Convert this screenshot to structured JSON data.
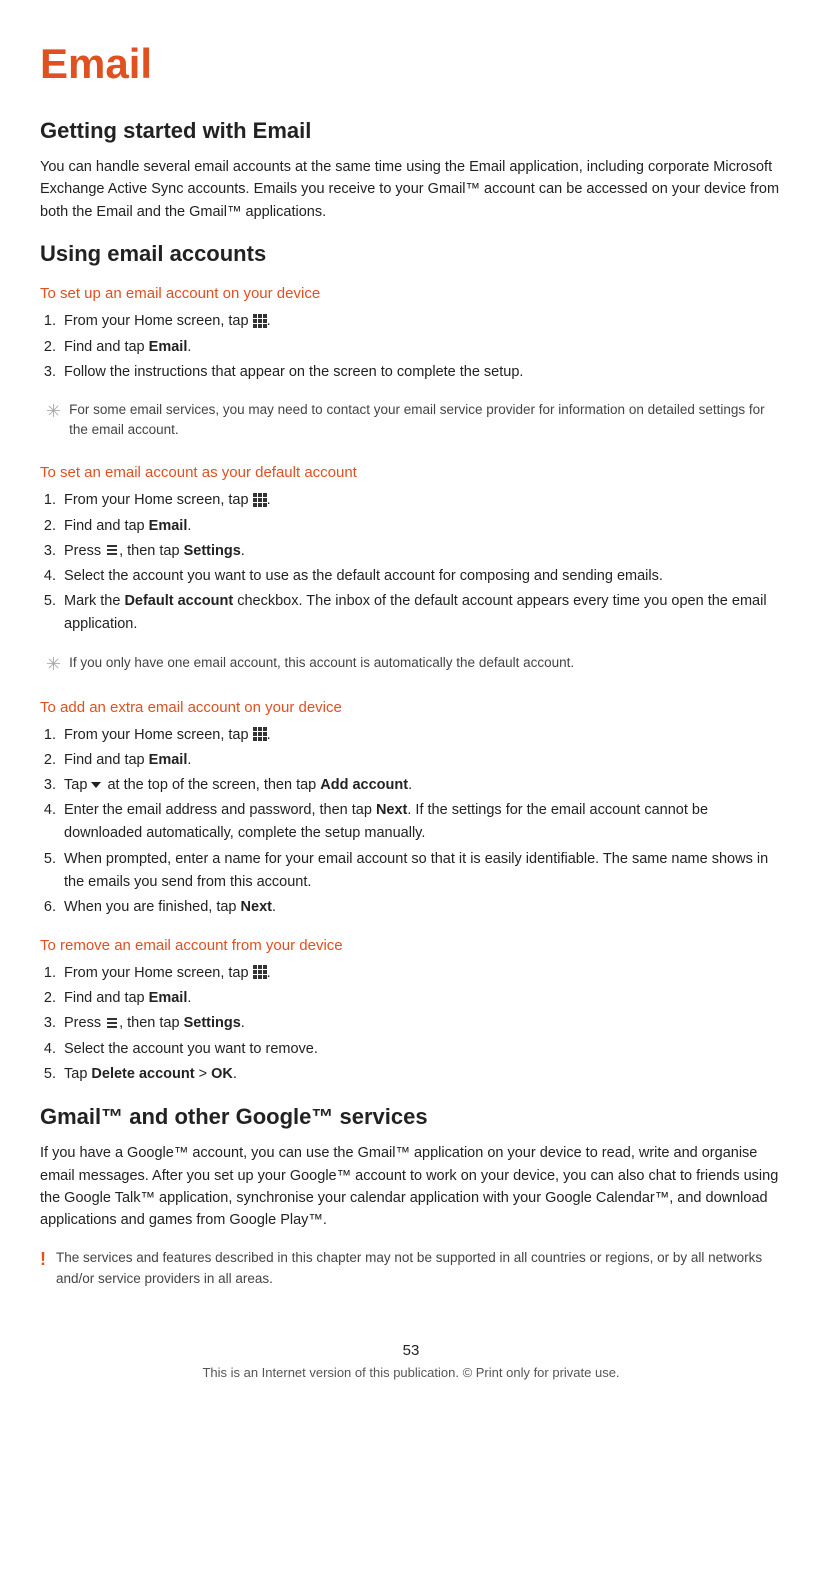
{
  "page": {
    "title": "Email",
    "section1": {
      "heading": "Getting started with Email",
      "body": "You can handle several email accounts at the same time using the Email application, including corporate Microsoft Exchange Active Sync accounts. Emails you receive to your Gmail™ account can be accessed on your device from both the Email and the Gmail™ applications."
    },
    "section2": {
      "heading": "Using email accounts",
      "sub1": {
        "heading": "To set up an email account on your device",
        "steps": [
          "From your Home screen, tap ⋮.",
          "Find and tap Email.",
          "Follow the instructions that appear on the screen to complete the setup."
        ],
        "tip": "For some email services, you may need to contact your email service provider for information on detailed settings for the email account."
      },
      "sub2": {
        "heading": "To set an email account as your default account",
        "steps": [
          "From your Home screen, tap ⋮.",
          "Find and tap Email.",
          "Press ⋮, then tap Settings.",
          "Select the account you want to use as the default account for composing and sending emails.",
          "Mark the Default account checkbox. The inbox of the default account appears every time you open the email application."
        ],
        "tip": "If you only have one email account, this account is automatically the default account."
      },
      "sub3": {
        "heading": "To add an extra email account on your device",
        "steps": [
          "From your Home screen, tap ⋮.",
          "Find and tap Email.",
          "Tap ▼ at the top of the screen, then tap Add account.",
          "Enter the email address and password, then tap Next. If the settings for the email account cannot be downloaded automatically, complete the setup manually.",
          "When prompted, enter a name for your email account so that it is easily identifiable. The same name shows in the emails you send from this account.",
          "When you are finished, tap Next."
        ]
      },
      "sub4": {
        "heading": "To remove an email account from your device",
        "steps": [
          "From your Home screen, tap ⋮.",
          "Find and tap Email.",
          "Press ⋮, then tap Settings.",
          "Select the account you want to remove.",
          "Tap Delete account > OK."
        ]
      }
    },
    "section3": {
      "heading": "Gmail™ and other Google™ services",
      "body": "If you have a Google™ account, you can use the Gmail™ application on your device to read, write and organise email messages. After you set up your Google™ account to work on your device, you can also chat to friends using the Google Talk™ application, synchronise your calendar application with your Google Calendar™, and download applications and games from Google Play™.",
      "note": "The services and features described in this chapter may not be supported in all countries or regions, or by all networks and/or service providers in all areas."
    },
    "footer": {
      "page_number": "53",
      "footnote": "This is an Internet version of this publication. © Print only for private use."
    }
  }
}
